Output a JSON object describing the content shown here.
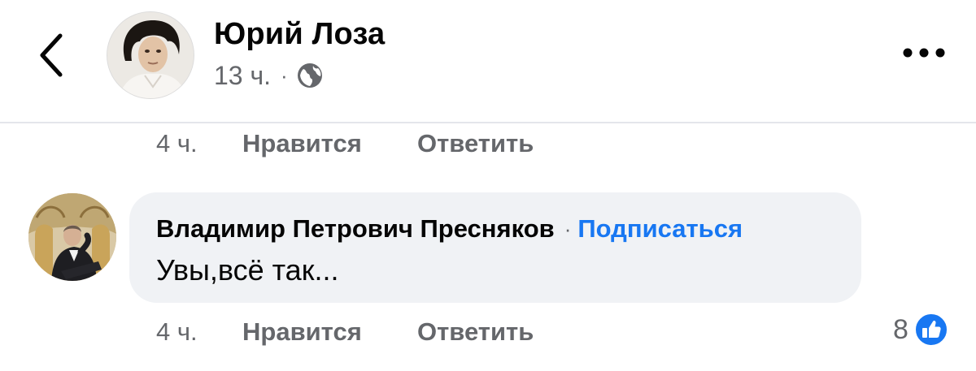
{
  "header": {
    "author_name": "Юрий Лоза",
    "post_time": "13 ч.",
    "meta_separator": "·",
    "privacy_icon": "globe-icon",
    "back_icon": "chevron-left-icon",
    "more_icon": "more-horizontal-icon"
  },
  "comments": [
    {
      "actions": {
        "time": "4 ч.",
        "like_label": "Нравится",
        "reply_label": "Ответить"
      }
    },
    {
      "author": "Владимир Петрович Пресняков",
      "separator": "·",
      "follow_label": "Подписаться",
      "text": "Увы,всё так...",
      "actions": {
        "time": "4 ч.",
        "like_label": "Нравится",
        "reply_label": "Ответить"
      },
      "reactions": {
        "count": "8",
        "icon": "like-thumb-icon"
      }
    }
  ],
  "colors": {
    "link_blue": "#1877f2",
    "secondary_text": "#65676b",
    "bubble_bg": "#f0f2f5",
    "divider": "#e4e6eb"
  }
}
